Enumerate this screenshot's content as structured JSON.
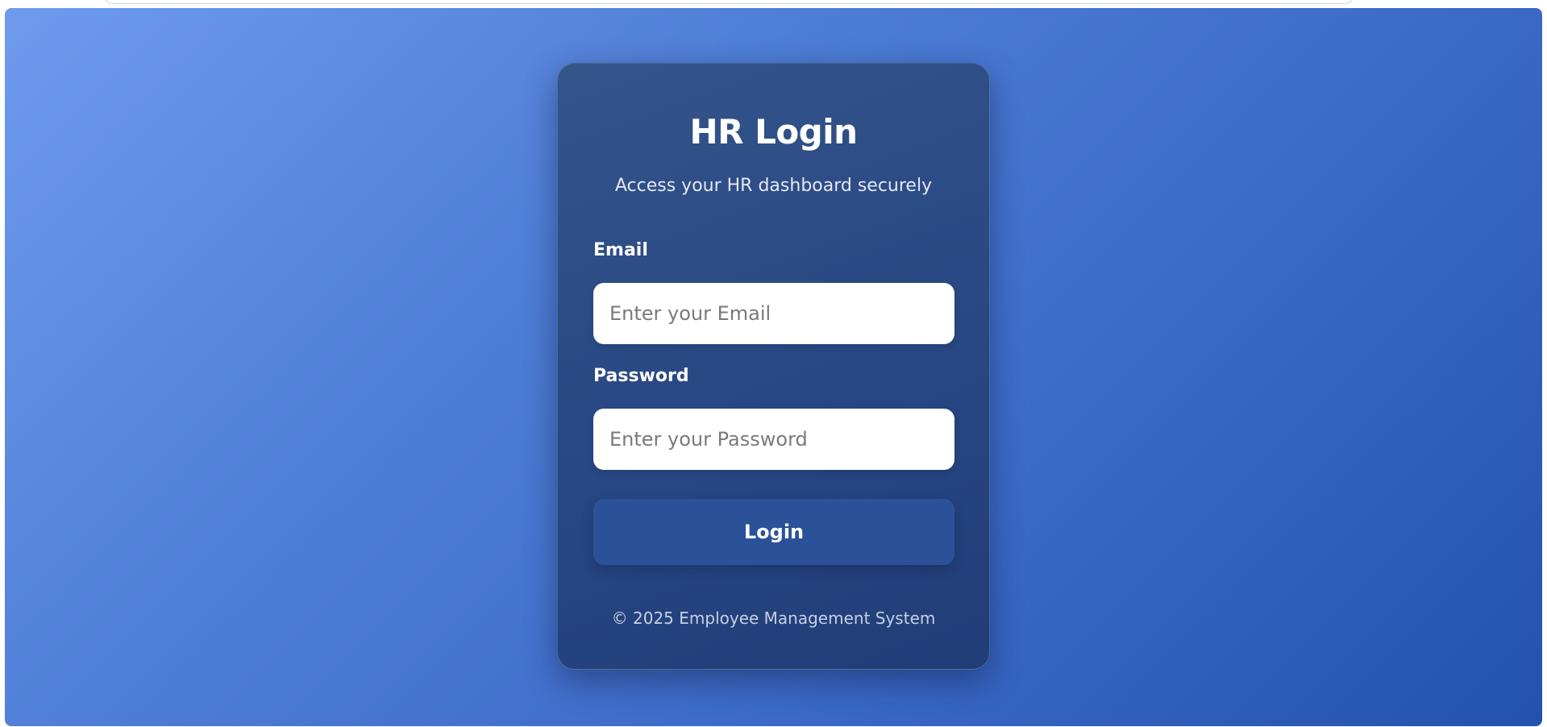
{
  "login_card": {
    "title": "HR Login",
    "subtitle": "Access your HR dashboard securely",
    "email": {
      "label": "Email",
      "placeholder": "Enter your Email",
      "value": ""
    },
    "password": {
      "label": "Password",
      "placeholder": "Enter your Password",
      "value": ""
    },
    "login_button_label": "Login",
    "footer": "© 2025 Employee Management System"
  },
  "colors": {
    "background_gradient_start": "#6e9bee",
    "background_gradient_end": "#2252ae",
    "card_background": "#284783",
    "button_background": "#2b5299",
    "input_background": "#ffffff"
  }
}
